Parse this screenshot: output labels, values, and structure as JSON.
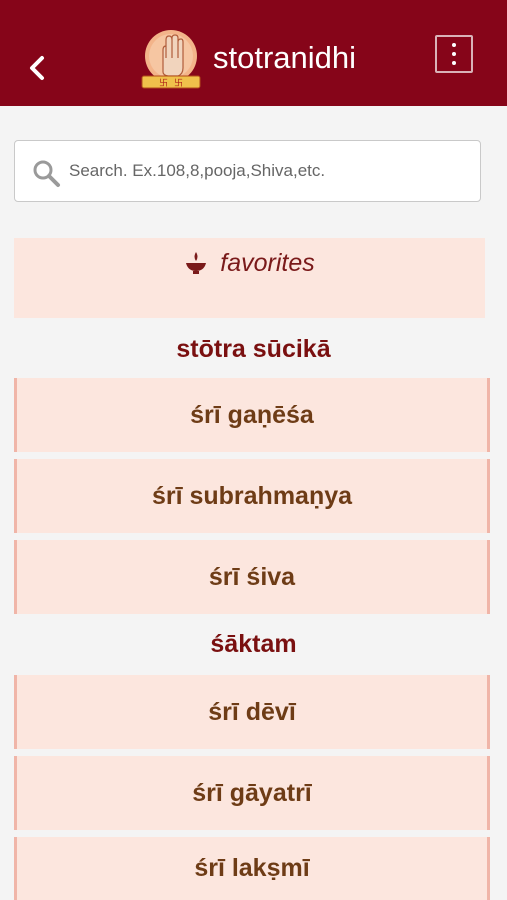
{
  "header": {
    "back_icon": "chevron-left-icon",
    "title": "stotranidhi",
    "menu_icon": "more-vertical-icon",
    "brand_color": "#860519"
  },
  "search": {
    "placeholder": "Search. Ex.108,8,pooja,Shiva,etc.",
    "icon": "search-icon"
  },
  "favorites": {
    "icon": "diya-lamp-icon",
    "label": "favorites"
  },
  "sections": [
    {
      "title": "stōtra sūcikā",
      "items": [
        "śrī gaṇēśa",
        "śrī subrahmaṇya",
        "śrī śiva"
      ]
    },
    {
      "title": "śāktam",
      "items": [
        "śrī dēvī",
        "śrī gāyatrī",
        "śrī lakṣmī"
      ]
    }
  ]
}
